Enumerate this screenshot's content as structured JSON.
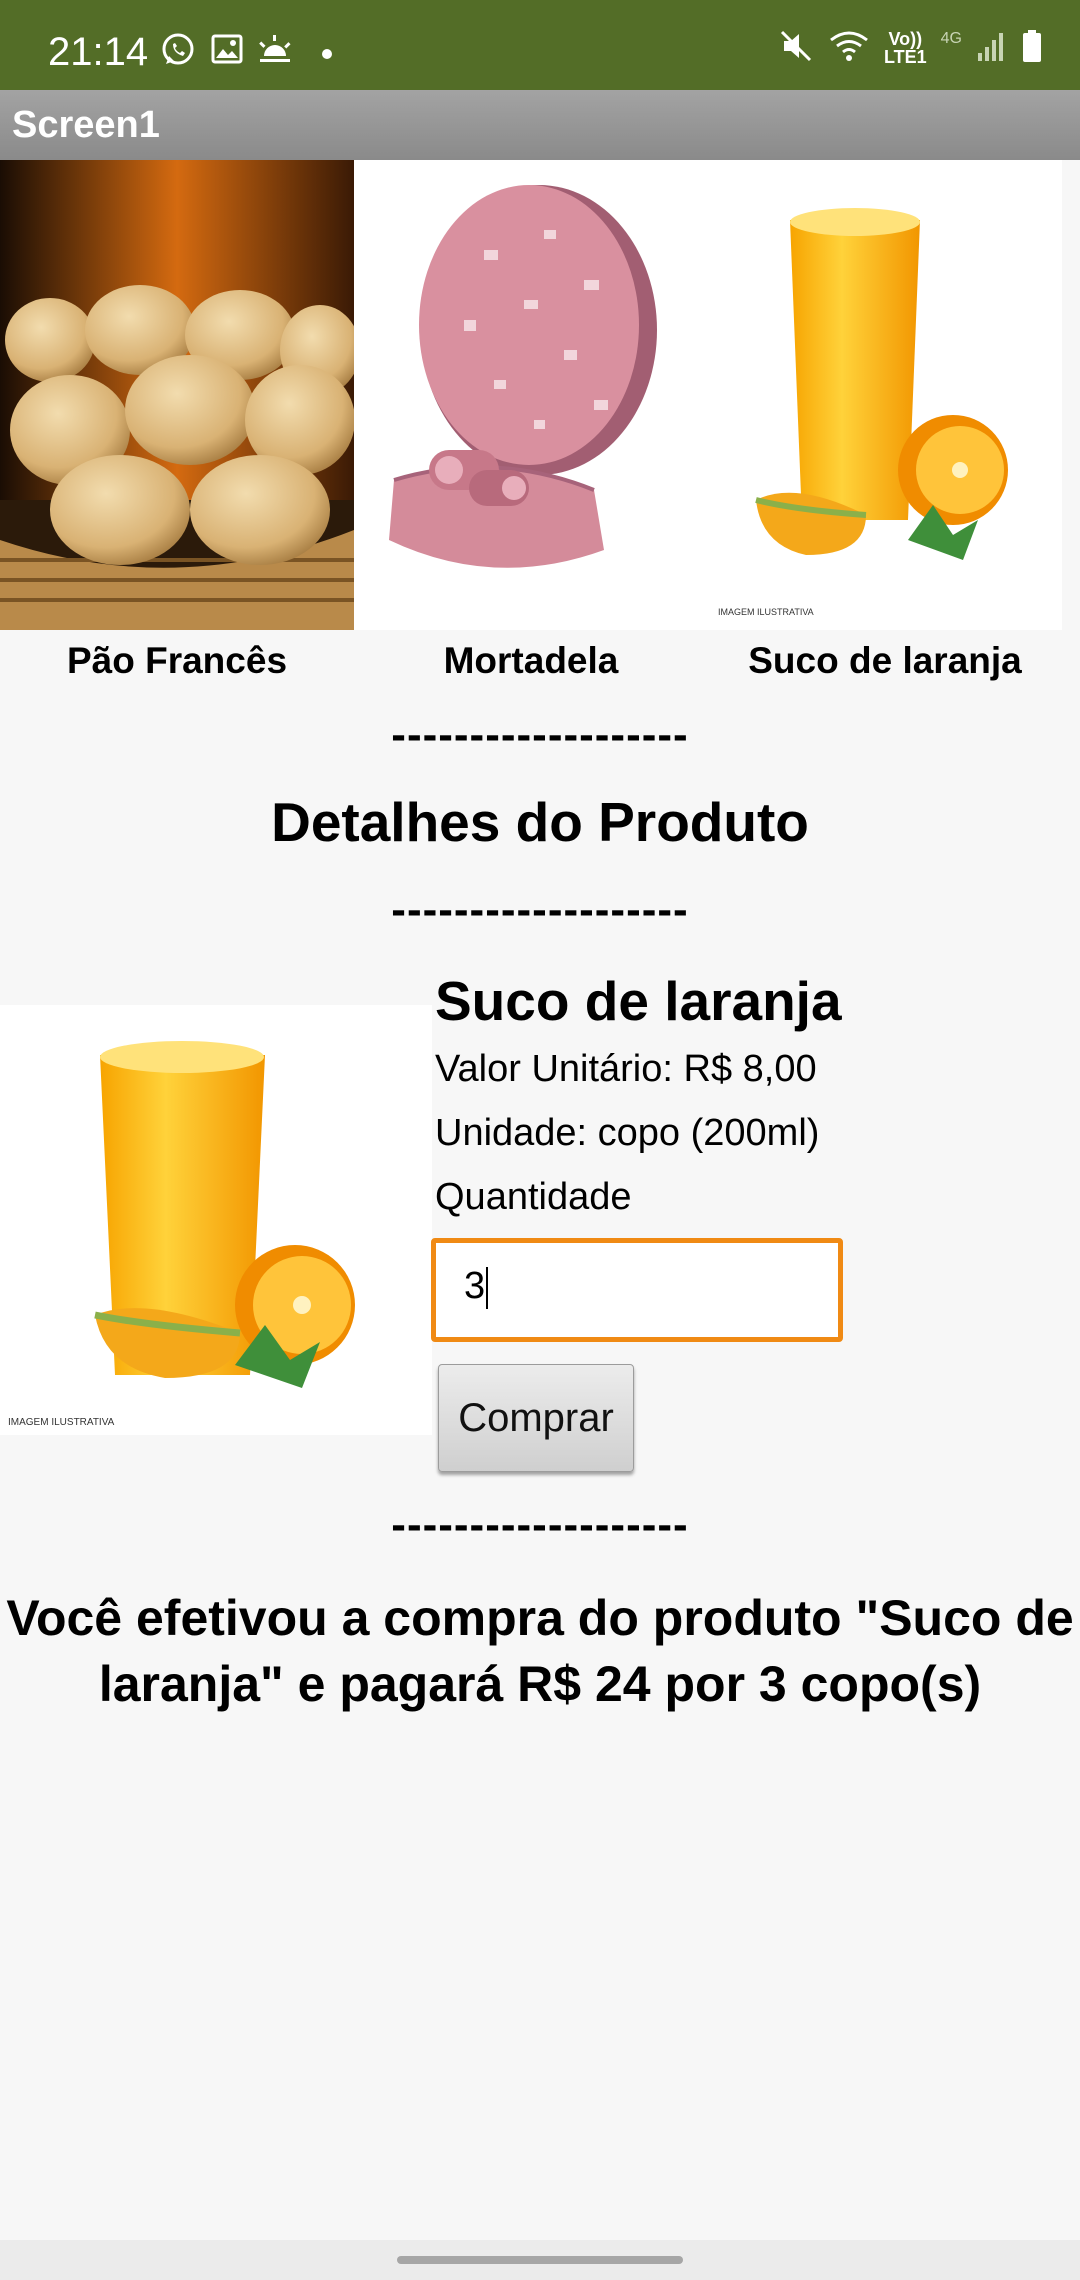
{
  "status_bar": {
    "time": "21:14",
    "icons_left": [
      "whatsapp-icon",
      "gallery-icon",
      "weather-icon",
      "dot-icon"
    ],
    "network_label_top": "Vo))",
    "network_label_bottom": "LTE1",
    "network_type": "4G",
    "icons_right": [
      "mute-icon",
      "wifi-icon",
      "signal-icon",
      "battery-icon"
    ],
    "background_color": "#536d27"
  },
  "title_bar": {
    "title": "Screen1"
  },
  "products": [
    {
      "name": "Pão Francês",
      "image": "bread-image"
    },
    {
      "name": "Mortadela",
      "image": "mortadella-image"
    },
    {
      "name": "Suco de laranja",
      "image": "orange-juice-image"
    }
  ],
  "separator": "-------------------",
  "section_title": "Detalhes do Produto",
  "detail": {
    "image": "orange-juice-image",
    "image_caption": "IMAGEM ILUSTRATIVA",
    "name": "Suco de laranja",
    "unit_price": "Valor Unitário: R$ 8,00",
    "unit": "Unidade: copo (200ml)",
    "quantity_label": "Quantidade",
    "quantity_value": "3",
    "buy_button": "Comprar"
  },
  "result_message": "Você efetivou a compra do produto \"Suco de laranja\" e pagará R$ 24 por 3 copo(s)",
  "colors": {
    "input_focus": "#f08a14",
    "accent": "#536d27"
  }
}
